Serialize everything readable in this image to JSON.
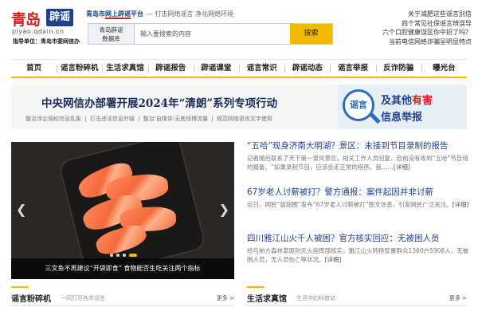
{
  "logo": {
    "main": "青岛",
    "badge": "辟谣",
    "domain": "piyao.qdxin.cn",
    "guide": "指导单位：青岛市委网信办"
  },
  "platform": {
    "city": "青岛市",
    "name": "网上辟谣",
    "suffix": "平台",
    "slogan": "— 打击网络谣言 净化网络环境"
  },
  "search": {
    "db_label_1": "青岛辟谣",
    "db_label_2": "数据库",
    "placeholder": "输入要搜索的内容",
    "button": "搜索"
  },
  "quick_links": [
    "关于减肥这些谣言别信",
    "四个常见社保谣言辨误导",
    "六个口腔健康误区你中招了吗？",
    "当前电信网络诈骗呈明显特点"
  ],
  "nav": [
    "首页",
    "谣言粉碎机",
    "生活求真馆",
    "辟谣报告",
    "辟谣课堂",
    "谣言常识",
    "辟谣动态",
    "谣言举报",
    "反诈防骗",
    "曝光台"
  ],
  "banner": {
    "title": "中央网信办部署开展2024年“清朗”系列专项行动",
    "sub": [
      "整治涉企侵权信息乱象",
      "|",
      "打击违法信息外链",
      "|",
      "整治‘自媒体’无底线博流量",
      "|",
      "规范网络语言文字使用"
    ]
  },
  "report": {
    "icon_text": "谣言",
    "line1_a": "及其他",
    "line1_b": "有害",
    "line2": "信息举报"
  },
  "carousel": {
    "caption": "三文鱼不再建议“开袋即食”   食物能否生吃关注两个指标",
    "slides": 4,
    "active": 4
  },
  "news": [
    {
      "title": "“五哈”现身济南大明湖？景区：未接到节目录制的报告",
      "summary": "记者随后联系了天下第一泉风景区，相关工作人员回复，目前没有收到“五哈”节目组的报备。“如果录制节目，应该会走正常的程序。我……",
      "more": "[详细]"
    },
    {
      "title": "67岁老人讨薪被打？警方通报：案件起因并非讨薪",
      "summary": "近日，网民“甜甜圈”发布“67岁老人讨薪被打”图文信息，引发网民广泛关注。",
      "more": "[详细]"
    },
    {
      "title": "四川雅江山火千人被困？官方核实回应：无被困人员",
      "summary": "经与前方森林草原防灭火指挥部核实，雅江山火转移安置群众1360户5908人，无被困人员，无人员伤亡等状况。",
      "more": "[详细]"
    }
  ],
  "sections": [
    {
      "title": "谣言粉碎机",
      "sub": "一网打尽各类谣言",
      "more": "更多 >"
    },
    {
      "title": "生活求真馆",
      "sub": "生活中的科普站",
      "more": "更多 >"
    }
  ],
  "colors": {
    "brand_red": "#d81e1e",
    "brand_blue": "#1f3f8f",
    "accent_yellow": "#f4b800"
  }
}
